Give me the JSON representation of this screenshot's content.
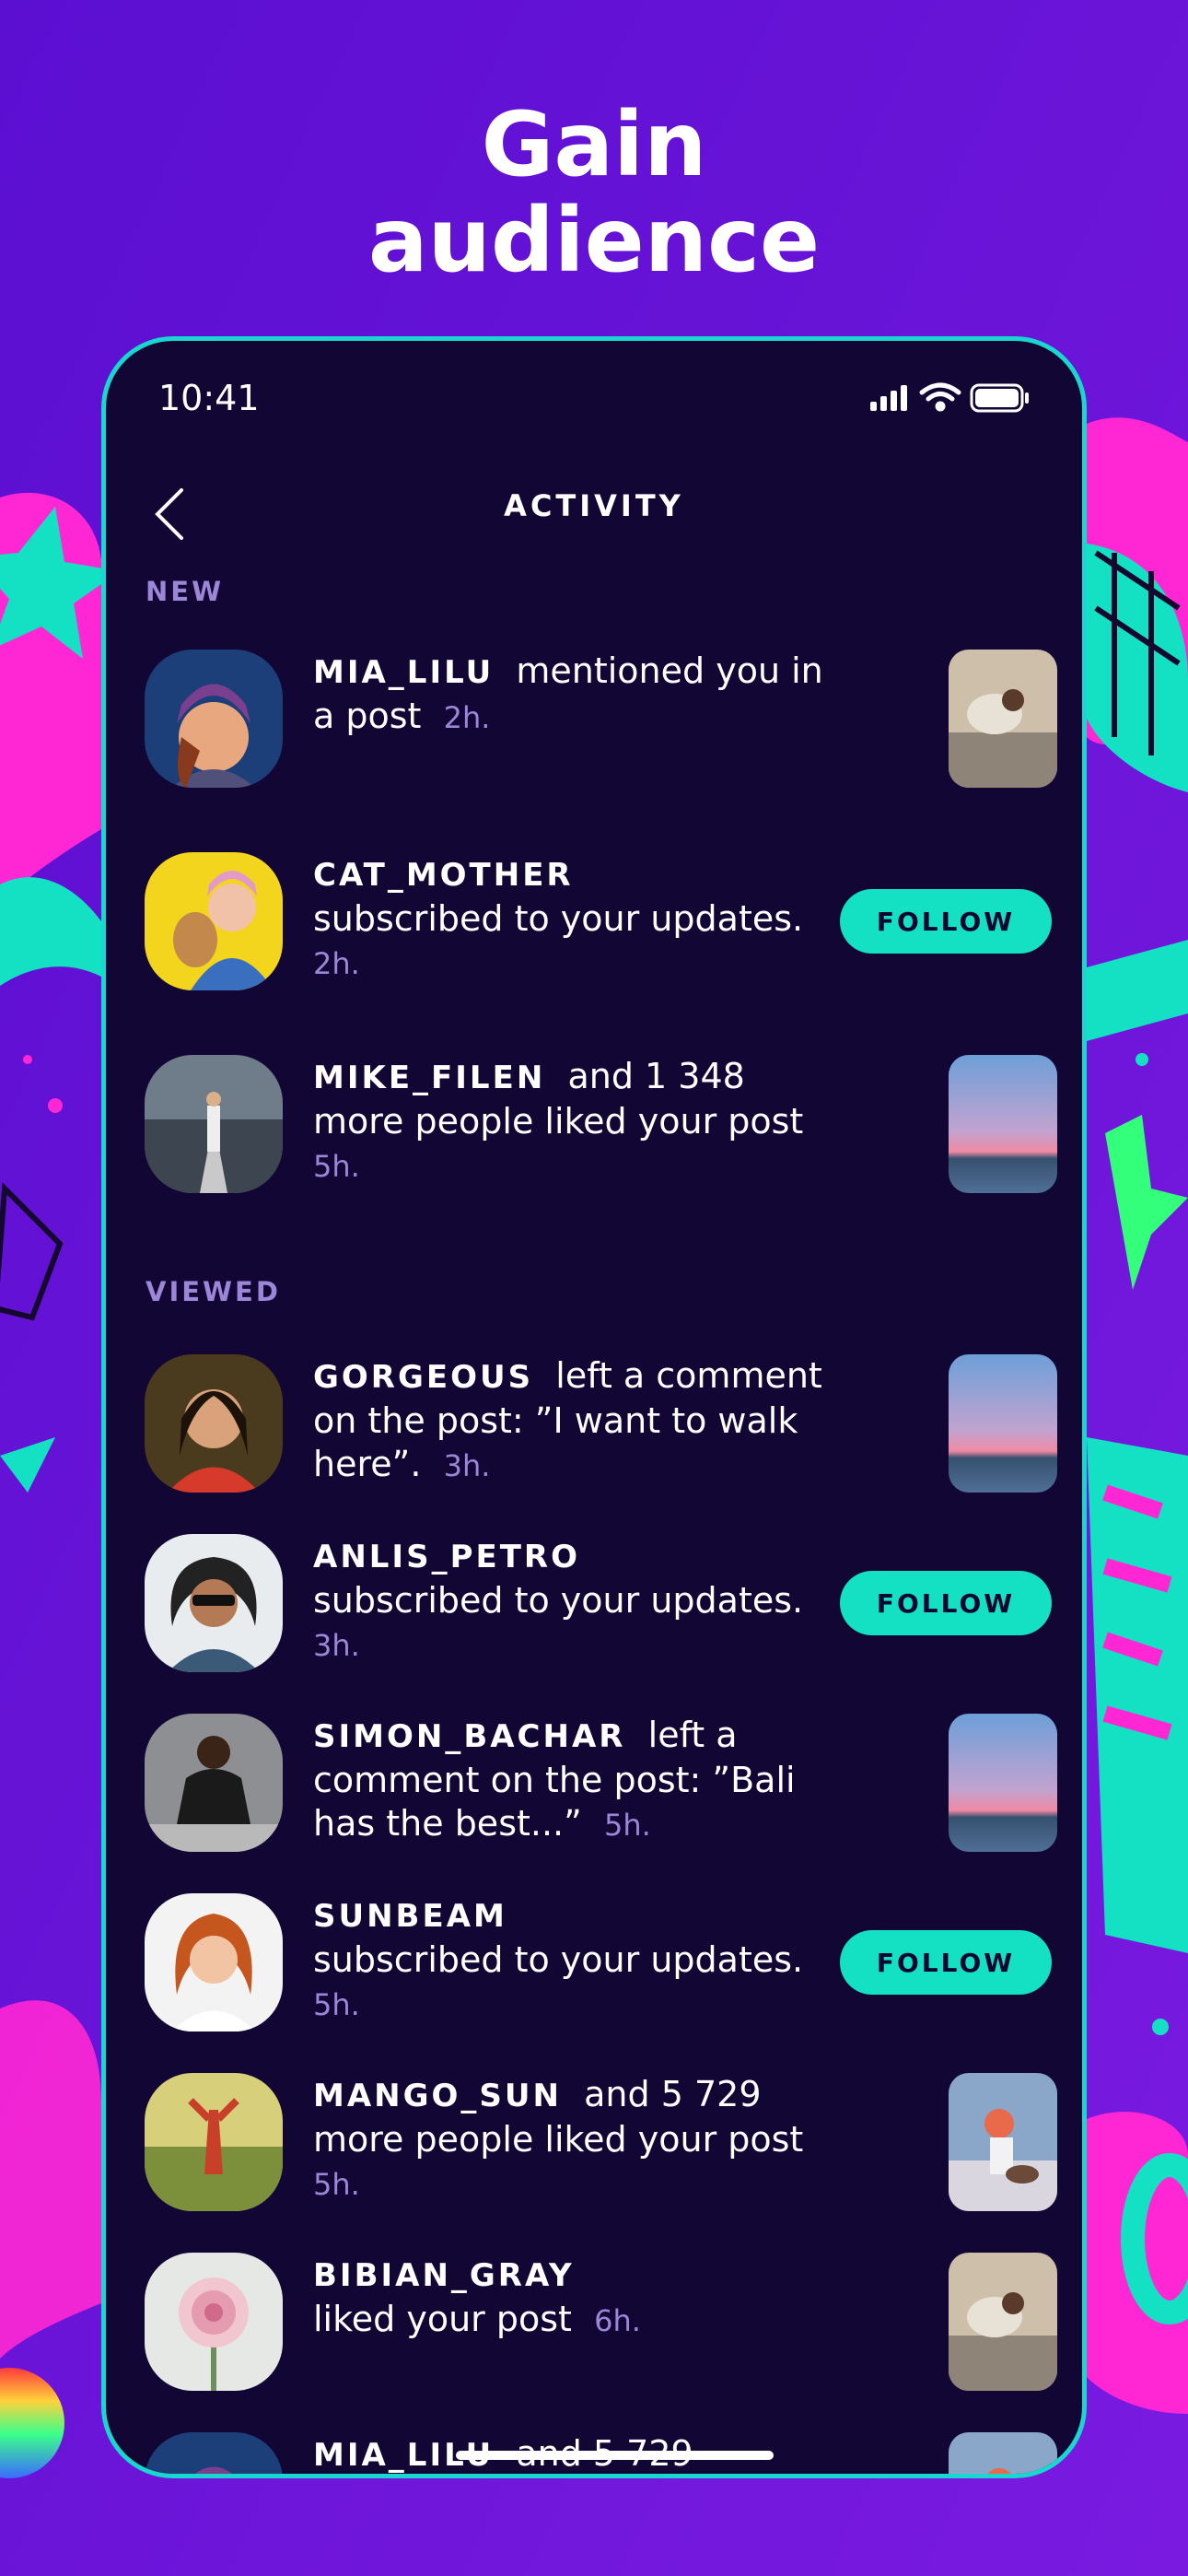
{
  "headline": {
    "line1": "Gain",
    "line2": "audience"
  },
  "status_bar": {
    "time": "10:41"
  },
  "screen": {
    "title": "ACTIVITY"
  },
  "sections": {
    "new": "NEW",
    "viewed": "VIEWED"
  },
  "follow_label": "FOLLOW",
  "items": [
    {
      "user": "MIA_LILU",
      "text": "mentioned you in a post",
      "time": "2h."
    },
    {
      "user": "CAT_MOTHER",
      "text": "subscribed to your updates.",
      "time": "2h."
    },
    {
      "user": "MIKE_FILEN",
      "text": "and 1 348 more people liked your post",
      "time": "5h."
    },
    {
      "user": "GORGEOUS",
      "text": "left a comment on the post: ”I want to walk here”.",
      "time": "3h."
    },
    {
      "user": "ANLIS_PETRO",
      "text": "subscribed to your updates.",
      "time": "3h."
    },
    {
      "user": "SIMON_BACHAR",
      "text": "left a comment on the post: ”Bali has the best...”",
      "time": "5h."
    },
    {
      "user": "SUNBEAM",
      "text": "subscribed to your updates.",
      "time": "5h."
    },
    {
      "user": "MANGO_SUN",
      "text": "and 5 729 more people liked your post",
      "time": "5h."
    },
    {
      "user": "BIBIAN_GRAY",
      "text": "liked your post",
      "time": "6h."
    },
    {
      "user": "MIA_LILU",
      "text": "and 5 729",
      "time": ""
    }
  ],
  "colors": {
    "accent": "#14e1c4",
    "background": "#6a12d6",
    "panel": "#120634",
    "muted": "#9b86d8"
  }
}
